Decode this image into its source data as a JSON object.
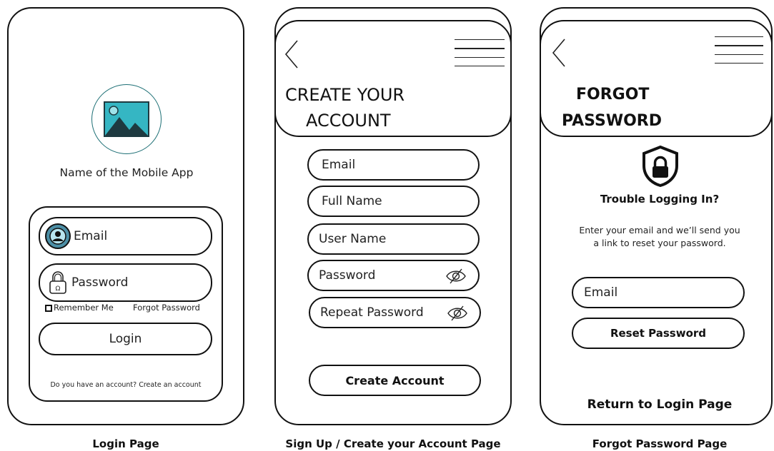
{
  "login": {
    "app_name": "Name of the Mobile App",
    "email_placeholder": "Email",
    "password_placeholder": "Password",
    "remember_me": "Remember Me",
    "forgot_password": "Forgot Password",
    "login_label": "Login",
    "footer": "Do you have an account? Create an account",
    "caption": "Login Page"
  },
  "signup": {
    "title_line1": "CREATE YOUR",
    "title_line2": "ACCOUNT",
    "fields": [
      "Email",
      "Full Name",
      "User Name",
      "Password",
      "Repeat Password"
    ],
    "create_label": "Create Account",
    "caption": "Sign Up / Create your Account Page"
  },
  "forgot": {
    "title_line1": "FORGOT",
    "title_line2": "PASSWORD",
    "heading": "Trouble Logging In?",
    "desc_line1": "Enter your email and we’ll send you",
    "desc_line2": "a link to reset your password.",
    "email_placeholder": "Email",
    "reset_label": "Reset Password",
    "return_label": "Return to Login Page",
    "caption": "Forgot Password Page"
  },
  "colors": {
    "accent": "#35b6c3",
    "ink": "#111111"
  }
}
